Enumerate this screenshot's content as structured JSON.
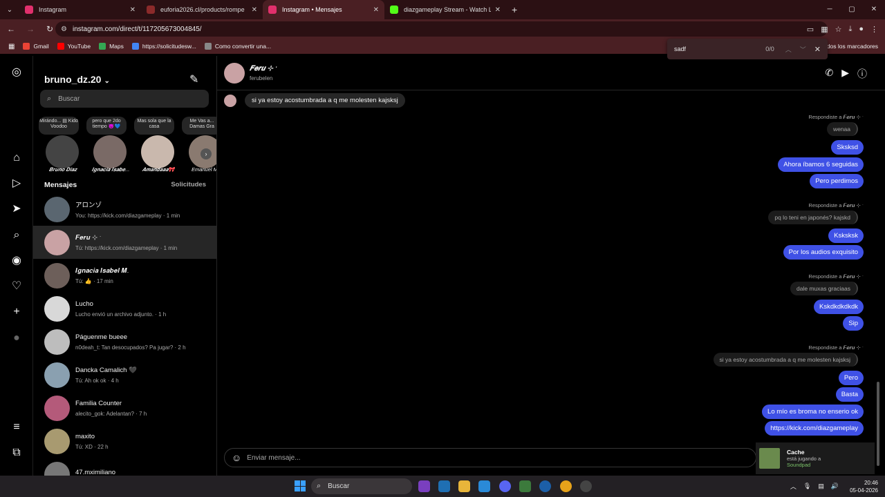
{
  "browser": {
    "tabs": [
      {
        "title": "Instagram",
        "color": "#e1306c",
        "active": false
      },
      {
        "title": "euforia2026.cl/products/rompe",
        "color": "#8b2a2a",
        "active": false
      },
      {
        "title": "Instagram • Mensajes",
        "color": "#e1306c",
        "active": true
      },
      {
        "title": "diazgameplay Stream - Watch L",
        "color": "#53fc18",
        "active": false
      }
    ],
    "url": "instagram.com/direct/t/117205673004845/",
    "bookmarks": [
      {
        "label": "Gmail",
        "color": "#ea4335"
      },
      {
        "label": "YouTube",
        "color": "#ff0000"
      },
      {
        "label": "Maps",
        "color": "#34a853"
      },
      {
        "label": "https://solicitudesw...",
        "color": "#4285f4"
      },
      {
        "label": "Como convertir una...",
        "color": "#888888"
      }
    ],
    "bookmarks_right": "dos los marcadores",
    "find": {
      "query": "sadf",
      "count": "0/0"
    }
  },
  "inbox": {
    "username": "bruno_dz.20",
    "search_placeholder": "Buscar",
    "notes": [
      {
        "text": "Mirándo... ▤ Kidd Voodoo",
        "name": "𝑩𝒓𝒖𝒏𝒐 𝑫𝒊𝒂𝒛",
        "color": "#444"
      },
      {
        "text": "pero que 2do tiempo 😈💙",
        "name": "𝑰𝒈𝒏𝒂𝒄𝒊𝒂 𝑰𝒔𝒂𝒃𝒆...",
        "color": "#7a6a66"
      },
      {
        "text": "Mas sola que la casa",
        "name": "𝑨𝒎𝒂𝒏𝒅𝒂𝒂𝒂🎀",
        "color": "#c9b8ad"
      },
      {
        "text": "Me Vas a... Damas Gra",
        "name": "Emanuel Me",
        "color": "#8a7a70"
      }
    ],
    "messages_label": "Mensajes",
    "requests_label": "Solicitudes",
    "threads": [
      {
        "name": "アロンゾ",
        "preview": "You: https://kick.com/diazgameplay · 1 min",
        "color": "#5a6670",
        "selected": false
      },
      {
        "name": "𝑭𝒆𝒓𝒖 ⊹ ˑ",
        "preview": "Tú: https://kick.com/diazgameplay · 1 min",
        "color": "#c9a2a4",
        "selected": true
      },
      {
        "name": "𝑰𝒈𝒏𝒂𝒄𝒊𝒂 𝑰𝒔𝒂𝒃𝒆𝒍 𝑴.",
        "preview": "Tú: 👍 · 17 min",
        "color": "#6d5f5a",
        "selected": false
      },
      {
        "name": "Lucho",
        "preview": "Lucho envió un archivo adjunto. · 1 h",
        "color": "#d8d8d8",
        "selected": false
      },
      {
        "name": "Páguenme bueee",
        "preview": "n0deah_t: Tan desocupados? Pa jugar? · 2 h",
        "color": "#bdbdbd",
        "selected": false
      },
      {
        "name": "Dancka Camalich 🖤",
        "preview": "Tú: Ah ok ok · 4 h",
        "color": "#8aa0b0",
        "selected": false
      },
      {
        "name": "Familia Counter",
        "preview": "alecito_gok: Adelantan? · 7 h",
        "color": "#b45a7a",
        "selected": false
      },
      {
        "name": "maxito",
        "preview": "Tú: XD · 22 h",
        "color": "#a89a70",
        "selected": false
      },
      {
        "name": "47.mximiliano",
        "preview": "",
        "color": "#777",
        "selected": false
      }
    ]
  },
  "conversation": {
    "name": "𝑭𝒆𝒓𝒖 ⊹ ˑ",
    "username": "ferubelen",
    "incoming_top": "si ya estoy acostumbrada a q me molesten kajsksj",
    "reply_to_label": "Respondiste a 𝑭𝒆𝒓𝒖 ⊹ ˑ",
    "blocks": [
      {
        "quote": "wenaa",
        "out": [
          "Sksksd",
          "Ahora íbamos 6 seguidas",
          "Pero perdimos"
        ]
      },
      {
        "quote": "pq lo teni en japonés? kajskd",
        "out": [
          "Ksksksk",
          "Por los audios exquisito"
        ]
      },
      {
        "quote": "dale muxas graciaas",
        "out": [
          "Kskdkdkdkdk",
          "Sip"
        ]
      },
      {
        "quote": "si ya estoy acostumbrada a q me molesten kajsksj",
        "out": [
          "Pero",
          "Basta",
          "Lo mío es broma no enserio ok",
          "https://kick.com/diazgameplay"
        ]
      }
    ],
    "composer_placeholder": "Enviar mensaje..."
  },
  "toast": {
    "title": "Cache",
    "status": "está jugando a",
    "game": "Soundpad"
  },
  "taskbar": {
    "search": "Buscar",
    "time": "20:46",
    "date": "05-04-2026"
  }
}
